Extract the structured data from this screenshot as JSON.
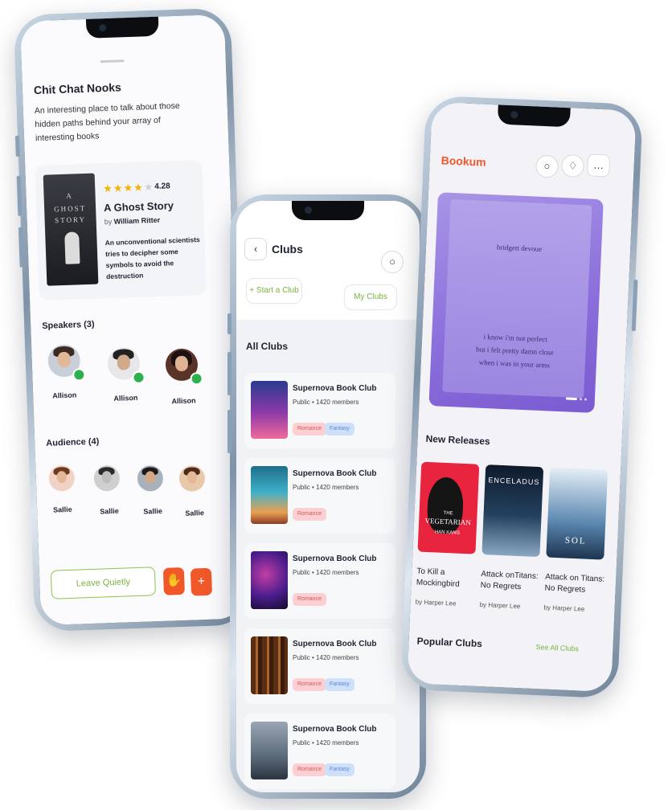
{
  "phone1": {
    "title": "Chit Chat Nooks",
    "description": "An interesting place to talk about those hidden paths behind your array of interesting books",
    "book": {
      "cover_line1": "A",
      "cover_line2": "GHOST",
      "cover_line3": "STORY",
      "rating": "4.28",
      "stars_filled": 4,
      "stars_total": 5,
      "title": "A Ghost Story",
      "by": "by",
      "author": "William Ritter",
      "summary": "An unconventional scientists tries to decipher some symbols to avoid the destruction"
    },
    "speakers_title": "Speakers (3)",
    "speakers": [
      {
        "name": "Allison"
      },
      {
        "name": "Allison"
      },
      {
        "name": "Allison"
      }
    ],
    "audience_title": "Audience (4)",
    "audience": [
      {
        "name": "Sallie"
      },
      {
        "name": "Sallie"
      },
      {
        "name": "Sallie"
      },
      {
        "name": "Sallie"
      }
    ],
    "leave_label": "Leave Quietly",
    "raise_hand_icon": "hand-icon",
    "add_icon": "plus-icon",
    "add_glyph": "+",
    "accent": "#f0582a"
  },
  "phone2": {
    "header_title": "Clubs",
    "back_glyph": "‹",
    "start_club": "Start a Club",
    "start_glyph": "+",
    "my_clubs": "My Clubs",
    "section_title": "All Clubs",
    "clubs": [
      {
        "name": "Supernova Book Club",
        "visibility": "Public",
        "members": "1420 members",
        "tags": [
          "Romance",
          "Fantasy"
        ]
      },
      {
        "name": "Supernova Book Club",
        "visibility": "Public",
        "members": "1420 members",
        "tags": [
          "Romance"
        ]
      },
      {
        "name": "Supernova Book Club",
        "visibility": "Public",
        "members": "1420 members",
        "tags": [
          "Romance"
        ]
      },
      {
        "name": "Supernova Book Club",
        "visibility": "Public",
        "members": "1420 members",
        "tags": [
          "Romance",
          "Fantasy"
        ]
      },
      {
        "name": "Supernova Book Club",
        "visibility": "Public",
        "members": "1420 members",
        "tags": [
          "Romance",
          "Fantasy"
        ]
      }
    ],
    "accent": "#7cb342"
  },
  "phone3": {
    "brand": "Bookum",
    "brand_color": "#f0582a",
    "hero": {
      "author": "bridgett devoue",
      "line1": "i know i'm not perfect",
      "line2": "but i felt pretty damn close",
      "line3": "when i was in your arms"
    },
    "new_releases_title": "New Releases",
    "releases": [
      {
        "title_l1": "To Kill a",
        "title_l2": "Mockingbird",
        "by": "by",
        "author": "Harper Lee",
        "cover_text1": "THE",
        "cover_text2": "VEGETARIAN",
        "cover_text3": "HAN KANG"
      },
      {
        "title_l1": "Attack onTitans:",
        "title_l2": "No Regrets",
        "by": "by",
        "author": "Harper Lee",
        "cover_text1": "ENCELADUS"
      },
      {
        "title_l1": "Attack on Titans:",
        "title_l2": "No Regrets",
        "by": "by",
        "author": "Harper Lee",
        "cover_text1": "SOL"
      }
    ],
    "popular_title": "Popular Clubs",
    "see_all": "See All Clubs"
  }
}
